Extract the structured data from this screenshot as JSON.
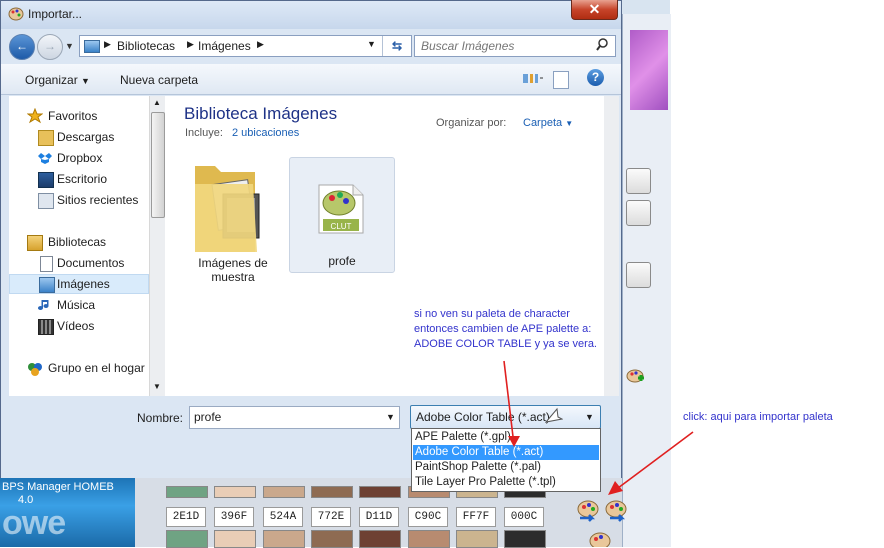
{
  "dialog": {
    "title": "Importar...",
    "close_glyph": "✕",
    "breadcrumb": [
      "Bibliotecas",
      "Imágenes"
    ],
    "search_placeholder": "Buscar Imágenes",
    "toolbar": {
      "organize": "Organizar",
      "new_folder": "Nueva carpeta"
    },
    "nav": {
      "favorites": "Favoritos",
      "fav_items": [
        "Descargas",
        "Dropbox",
        "Escritorio",
        "Sitios recientes"
      ],
      "libraries": "Bibliotecas",
      "lib_items": [
        "Documentos",
        "Imágenes",
        "Música",
        "Vídeos"
      ],
      "homegroup": "Grupo en el hogar"
    },
    "library": {
      "title": "Biblioteca Imágenes",
      "includes_label": "Incluye:",
      "includes_link": "2 ubicaciones",
      "arrange_label": "Organizar por:",
      "arrange_value": "Carpeta"
    },
    "files": [
      {
        "name": "Imágenes de muestra",
        "icon": "folder-icon"
      },
      {
        "name": "profe",
        "icon": "clut-file-icon"
      }
    ],
    "filename_label": "Nombre:",
    "filename_value": "profe",
    "filetype_selected": "Adobe Color Table (*.act)",
    "filetype_options": [
      "APE Palette (*.gpl)",
      "Adobe Color Table (*.act)",
      "PaintShop Palette (*.pal)",
      "Tile Layer Pro Palette (*.tpl)"
    ],
    "filetype_selected_index": 1
  },
  "annotations": {
    "note_lines": [
      "si no ven su paleta de character",
      "entonces cambien de APE palette a:",
      "ADOBE COLOR TABLE y ya se vera."
    ],
    "import_note": "click: aqui para importar paleta"
  },
  "background_app": {
    "logo_text": "BPS Manager HOMEB",
    "logo_version": "4.0",
    "color_codes": [
      "2E1D",
      "396F",
      "524A",
      "772E",
      "D11D",
      "C90C",
      "FF7F",
      "000C"
    ],
    "swatch_colors": [
      "#6fa383",
      "#e9cdb6",
      "#caa88c",
      "#8e6b52",
      "#6e4133",
      "#b88b70",
      "#cbb48f",
      "#2c2c2c"
    ]
  },
  "colors": {
    "note_blue": "#3333cc",
    "arrow_red": "#e02020",
    "selection_blue": "#3399ff"
  }
}
